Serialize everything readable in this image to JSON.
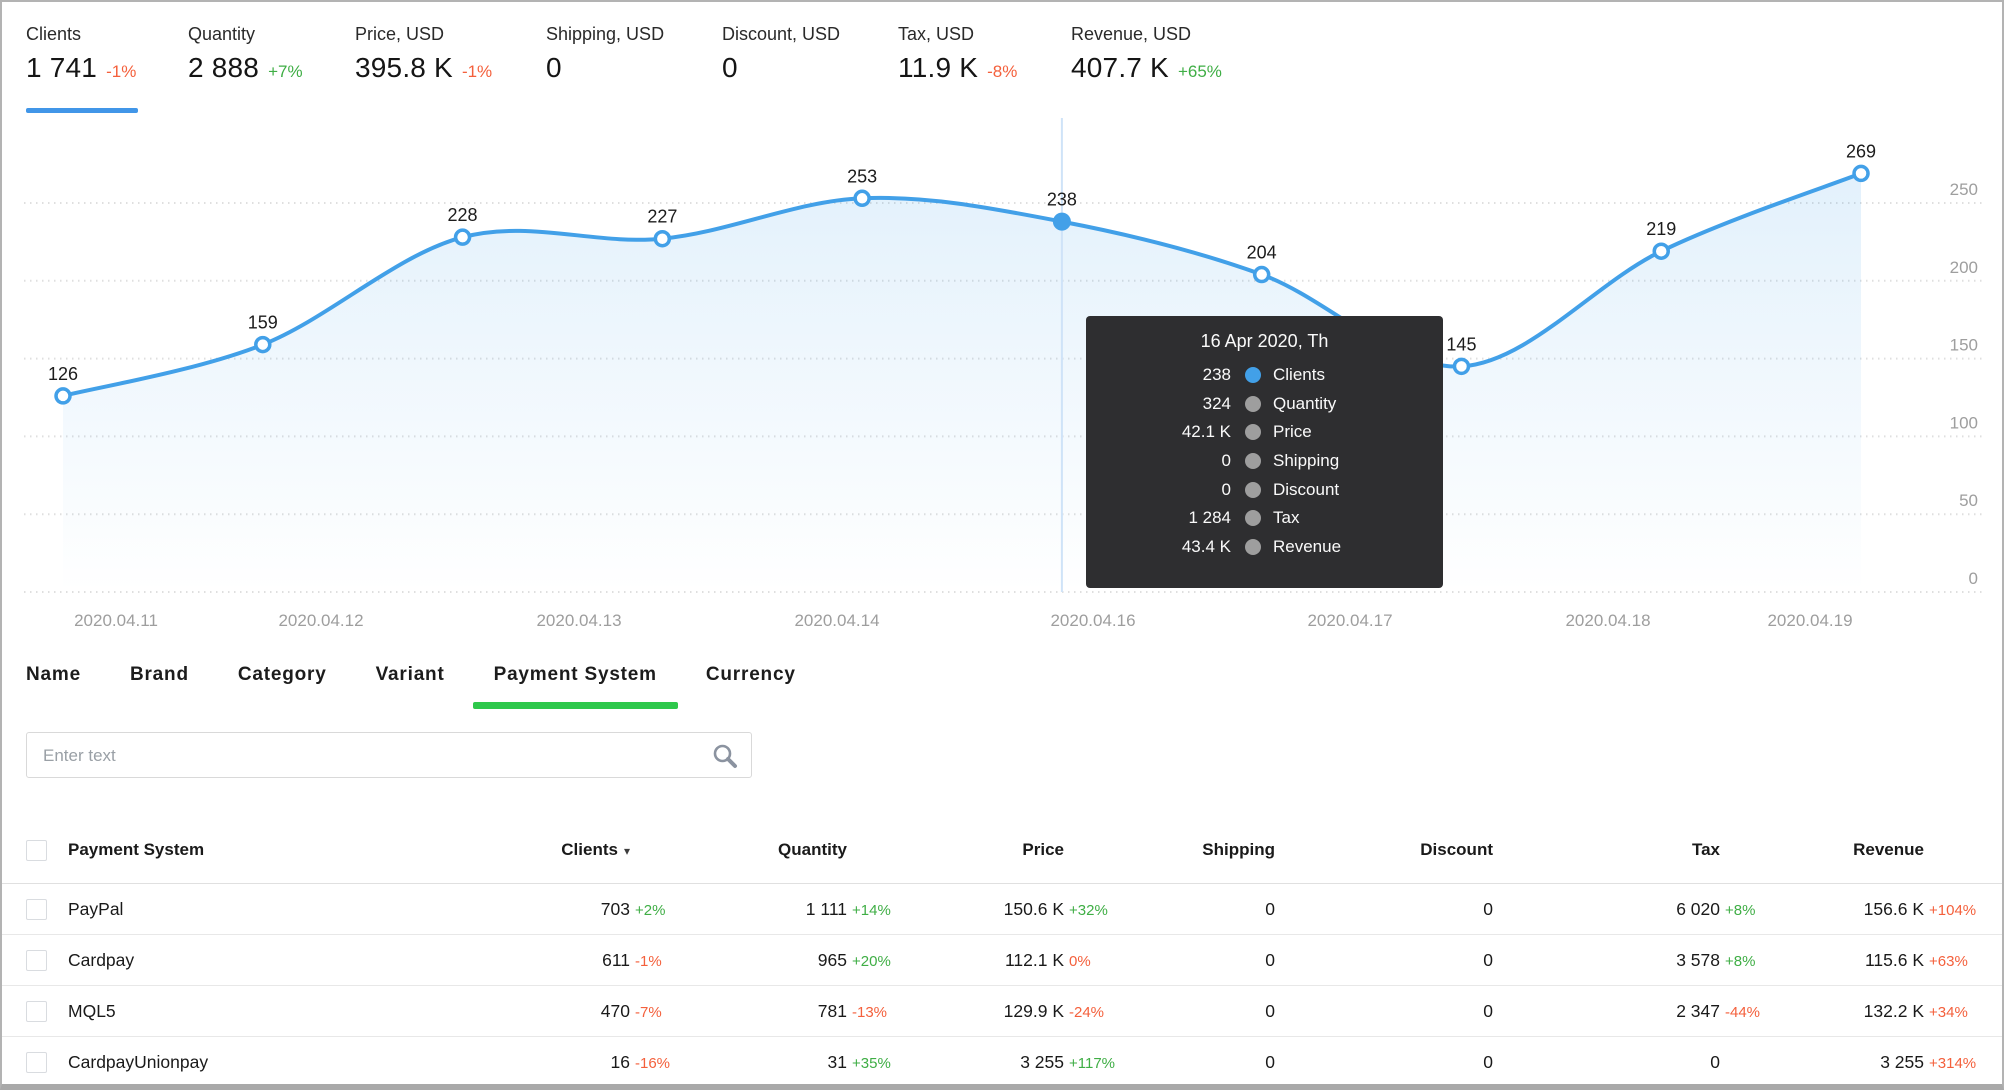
{
  "colors": {
    "blue": "#42a0e8",
    "underline_blue": "#4196e8",
    "green": "#3fae45",
    "red": "#f4603c",
    "tab_green": "#2ec84b",
    "axis_gray": "#9e9e9e",
    "grid_gray": "#dfdfdf",
    "tooltip_bg": "#2e2e30",
    "dot_gray": "#9e9e9e"
  },
  "kpis": [
    {
      "label": "Clients",
      "value": "1 741",
      "delta": "-1%",
      "delta_color": "red",
      "active": true
    },
    {
      "label": "Quantity",
      "value": "2 888",
      "delta": "+7%",
      "delta_color": "green",
      "active": false
    },
    {
      "label": "Price, USD",
      "value": "395.8 K",
      "delta": "-1%",
      "delta_color": "red",
      "active": false
    },
    {
      "label": "Shipping, USD",
      "value": "0",
      "delta": "",
      "delta_color": "",
      "active": false
    },
    {
      "label": "Discount, USD",
      "value": "0",
      "delta": "",
      "delta_color": "",
      "active": false
    },
    {
      "label": "Tax, USD",
      "value": "11.9 K",
      "delta": "-8%",
      "delta_color": "red",
      "active": false
    },
    {
      "label": "Revenue, USD",
      "value": "407.7 K",
      "delta": "+65%",
      "delta_color": "green",
      "active": false
    }
  ],
  "chart_data": {
    "type": "line",
    "series": [
      {
        "name": "Clients",
        "values": [
          126,
          159,
          228,
          227,
          253,
          238,
          204,
          145,
          219,
          269
        ]
      }
    ],
    "point_labels": [
      "126",
      "159",
      "228",
      "227",
      "253",
      "238",
      "204",
      "145",
      "219",
      "269"
    ],
    "x_labels": [
      "2020.04.11",
      "2020.04.12",
      "2020.04.13",
      "2020.04.14",
      "2020.04.16",
      "2020.04.17",
      "2020.04.18",
      "2020.04.19"
    ],
    "y_ticks": [
      0,
      50,
      100,
      150,
      200,
      250
    ],
    "ylim": [
      0,
      280
    ],
    "grid": "dotted horizontal",
    "legend_position": "none",
    "active_point_index": 5
  },
  "tooltip": {
    "title": "16 Apr 2020, Th",
    "rows": [
      {
        "value": "238",
        "label": "Clients",
        "dot": "blue"
      },
      {
        "value": "324",
        "label": "Quantity",
        "dot": "gray"
      },
      {
        "value": "42.1 K",
        "label": "Price",
        "dot": "gray"
      },
      {
        "value": "0",
        "label": "Shipping",
        "dot": "gray"
      },
      {
        "value": "0",
        "label": "Discount",
        "dot": "gray"
      },
      {
        "value": "1 284",
        "label": "Tax",
        "dot": "gray"
      },
      {
        "value": "43.4 K",
        "label": "Revenue",
        "dot": "gray"
      }
    ]
  },
  "tabs": [
    {
      "label": "Name",
      "active": false
    },
    {
      "label": "Brand",
      "active": false
    },
    {
      "label": "Category",
      "active": false
    },
    {
      "label": "Variant",
      "active": false
    },
    {
      "label": "Payment System",
      "active": true
    },
    {
      "label": "Currency",
      "active": false
    }
  ],
  "search": {
    "placeholder": "Enter text"
  },
  "table": {
    "columns": [
      "Payment System",
      "Clients",
      "Quantity",
      "Price",
      "Shipping",
      "Discount",
      "Tax",
      "Revenue"
    ],
    "sorted_column": "Clients",
    "sort_direction": "desc",
    "rows": [
      {
        "name": "PayPal",
        "cells": [
          {
            "v": "703",
            "p": "+2%",
            "c": "green"
          },
          {
            "v": "1 111",
            "p": "+14%",
            "c": "green"
          },
          {
            "v": "150.6 K",
            "p": "+32%",
            "c": "green"
          },
          {
            "v": "0",
            "p": "",
            "c": ""
          },
          {
            "v": "0",
            "p": "",
            "c": ""
          },
          {
            "v": "6 020",
            "p": "+8%",
            "c": "green"
          },
          {
            "v": "156.6 K",
            "p": "+104%",
            "c": "red"
          }
        ]
      },
      {
        "name": "Cardpay",
        "cells": [
          {
            "v": "611",
            "p": "-1%",
            "c": "red"
          },
          {
            "v": "965",
            "p": "+20%",
            "c": "green"
          },
          {
            "v": "112.1 K",
            "p": "0%",
            "c": "red"
          },
          {
            "v": "0",
            "p": "",
            "c": ""
          },
          {
            "v": "0",
            "p": "",
            "c": ""
          },
          {
            "v": "3 578",
            "p": "+8%",
            "c": "green"
          },
          {
            "v": "115.6 K",
            "p": "+63%",
            "c": "red"
          }
        ]
      },
      {
        "name": "MQL5",
        "cells": [
          {
            "v": "470",
            "p": "-7%",
            "c": "red"
          },
          {
            "v": "781",
            "p": "-13%",
            "c": "red"
          },
          {
            "v": "129.9 K",
            "p": "-24%",
            "c": "red"
          },
          {
            "v": "0",
            "p": "",
            "c": ""
          },
          {
            "v": "0",
            "p": "",
            "c": ""
          },
          {
            "v": "2 347",
            "p": "-44%",
            "c": "red"
          },
          {
            "v": "132.2 K",
            "p": "+34%",
            "c": "red"
          }
        ]
      },
      {
        "name": "CardpayUnionpay",
        "cells": [
          {
            "v": "16",
            "p": "-16%",
            "c": "red"
          },
          {
            "v": "31",
            "p": "+35%",
            "c": "green"
          },
          {
            "v": "3 255",
            "p": "+117%",
            "c": "green"
          },
          {
            "v": "0",
            "p": "",
            "c": ""
          },
          {
            "v": "0",
            "p": "",
            "c": ""
          },
          {
            "v": "0",
            "p": "",
            "c": ""
          },
          {
            "v": "3 255",
            "p": "+314%",
            "c": "red"
          }
        ]
      }
    ]
  }
}
